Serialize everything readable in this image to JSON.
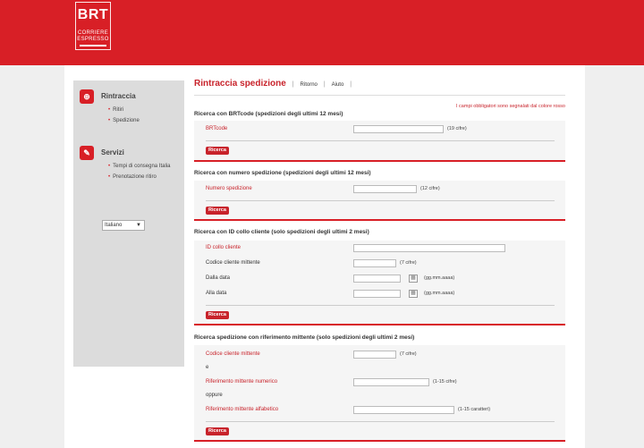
{
  "brand": {
    "name": "BRT",
    "line1": "CORRIERE",
    "line2": "ESPRESSO"
  },
  "sidebar": {
    "sections": [
      {
        "title": "Rintraccia",
        "icon": "globe-icon",
        "glyph": "⊕",
        "links": [
          "Ritiri",
          "Spedizione"
        ]
      },
      {
        "title": "Servizi",
        "icon": "document-icon",
        "glyph": "✎",
        "links": [
          "Tempi di consegna Italia",
          "Prenotazione ritiro"
        ]
      }
    ],
    "language": "Italiano"
  },
  "header": {
    "title": "Rintraccia spedizione",
    "links": [
      "Ritorno",
      "Aiuto"
    ]
  },
  "required_note": "I campi obbligatori sono segnalati dal colore rosso",
  "sections": [
    {
      "title": "Ricerca con BRTcode (spedizioni degli ultimi 12 mesi)",
      "fields": [
        {
          "label": "BRTcode",
          "hint": "(19 cifre)"
        }
      ],
      "button": "Ricerca"
    },
    {
      "title": "Ricerca con numero spedizione (spedizioni degli ultimi 12 mesi)",
      "fields": [
        {
          "label": "Numero spedizione",
          "hint": "(12 cifre)"
        }
      ],
      "button": "Ricerca"
    },
    {
      "title": "Ricerca con ID collo cliente (solo spedizioni degli ultimi 2 mesi)",
      "fields": [
        {
          "label": "ID collo cliente",
          "hint": ""
        },
        {
          "label": "Codice cliente mittente",
          "hint": "(7 cifre)"
        },
        {
          "label": "Dalla data",
          "hint": "(gg.mm.aaaa)"
        },
        {
          "label": "Alla data",
          "hint": "(gg.mm.aaaa)"
        }
      ],
      "button": "Ricerca"
    },
    {
      "title": "Ricerca spedizione con riferimento mittente (solo spedizioni degli ultimi 2 mesi)",
      "fields": [
        {
          "label": "Codice cliente mittente",
          "hint": "(7 cifre)"
        },
        {
          "label": "Riferimento mittente numerico",
          "hint": "(1-15 cifre)"
        },
        {
          "label": "Riferimento mittente alfabetico",
          "hint": "(1-15 caratteri)"
        }
      ],
      "connectors": [
        "e",
        "oppure"
      ],
      "button": "Ricerca"
    }
  ],
  "colors": {
    "brand_red": "#d81f26",
    "label_red": "#c8232b"
  }
}
